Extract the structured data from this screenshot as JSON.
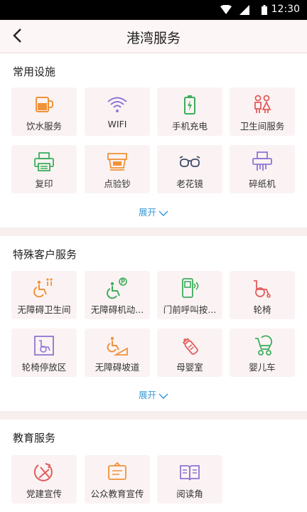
{
  "status_bar": {
    "time": "12:30"
  },
  "header": {
    "title": "港湾服务"
  },
  "sections": [
    {
      "title": "常用设施",
      "expand_label": "展开",
      "items": [
        {
          "label": "饮水服务",
          "icon": "water-cup-icon"
        },
        {
          "label": "WIFI",
          "icon": "wifi-icon"
        },
        {
          "label": "手机充电",
          "icon": "battery-charge-icon"
        },
        {
          "label": "卫生间服务",
          "icon": "restroom-icon"
        },
        {
          "label": "复印",
          "icon": "printer-icon"
        },
        {
          "label": "点验钞",
          "icon": "cash-counter-icon"
        },
        {
          "label": "老花镜",
          "icon": "glasses-icon"
        },
        {
          "label": "碎纸机",
          "icon": "shredder-icon"
        }
      ]
    },
    {
      "title": "特殊客户服务",
      "expand_label": "展开",
      "items": [
        {
          "label": "无障碍卫生间",
          "icon": "accessible-restroom-icon"
        },
        {
          "label": "无障碍机动...",
          "icon": "accessible-parking-icon"
        },
        {
          "label": "门前呼叫按...",
          "icon": "call-button-icon"
        },
        {
          "label": "轮椅",
          "icon": "wheelchair-icon"
        },
        {
          "label": "轮椅停放区",
          "icon": "wheelchair-parking-icon"
        },
        {
          "label": "无障碍坡道",
          "icon": "ramp-icon"
        },
        {
          "label": "母婴室",
          "icon": "baby-bottle-icon"
        },
        {
          "label": "婴儿车",
          "icon": "stroller-icon"
        }
      ]
    },
    {
      "title": "教育服务",
      "items": [
        {
          "label": "党建宣传",
          "icon": "party-emblem-icon"
        },
        {
          "label": "公众教育宣传",
          "icon": "info-board-icon"
        },
        {
          "label": "阅读角",
          "icon": "book-icon"
        }
      ]
    }
  ],
  "colors": {
    "orange": "#f0923a",
    "purple": "#8f74d8",
    "green": "#3cae5c",
    "red": "#e35b5b",
    "blue_link": "#3a9ad9",
    "tile_bg": "#fbf3f3"
  }
}
